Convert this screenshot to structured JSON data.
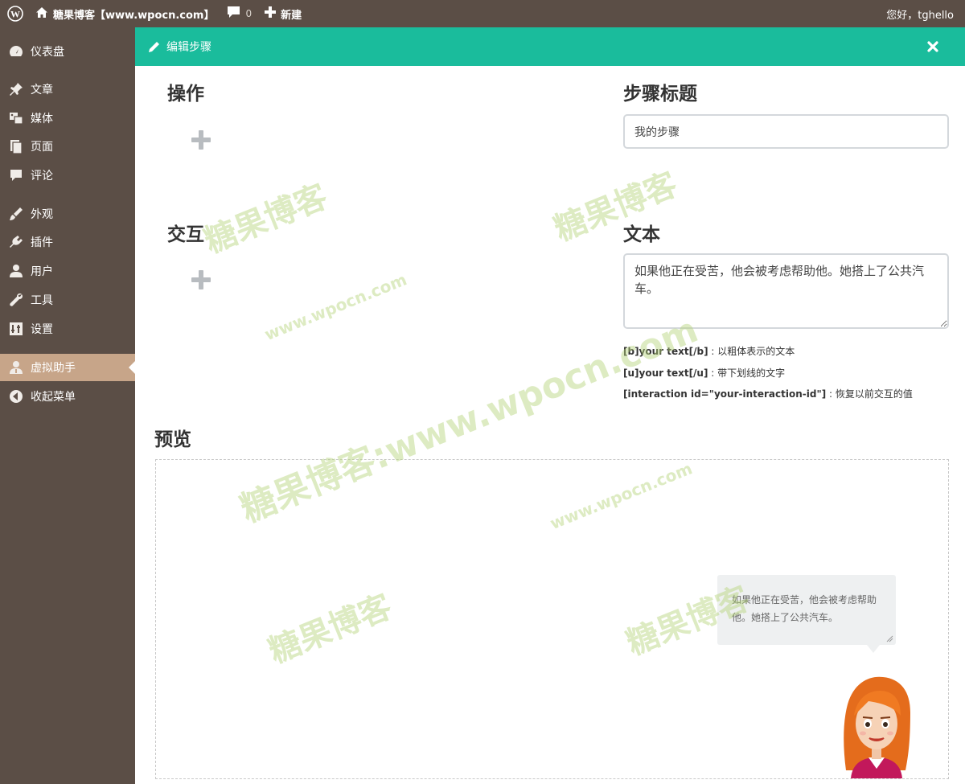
{
  "adminbar": {
    "site_name": "糖果博客【www.wpocn.com】",
    "comments_count": "0",
    "new_label": "新建",
    "greeting": "您好，tghello"
  },
  "sidebar": {
    "items": [
      {
        "label": "仪表盘",
        "icon": "dashboard-icon"
      },
      {
        "label": "文章",
        "icon": "pin-icon"
      },
      {
        "label": "媒体",
        "icon": "media-icon"
      },
      {
        "label": "页面",
        "icon": "pages-icon"
      },
      {
        "label": "评论",
        "icon": "comments-icon"
      },
      {
        "label": "外观",
        "icon": "appearance-icon"
      },
      {
        "label": "插件",
        "icon": "plugins-icon"
      },
      {
        "label": "用户",
        "icon": "users-icon"
      },
      {
        "label": "工具",
        "icon": "tools-icon"
      },
      {
        "label": "设置",
        "icon": "settings-icon"
      },
      {
        "label": "虚拟助手",
        "icon": "assistant-icon"
      },
      {
        "label": "收起菜单",
        "icon": "collapse-icon"
      }
    ],
    "active_index": 10
  },
  "modal": {
    "title": "编辑步骤"
  },
  "sections": {
    "actions": "操作",
    "interactions": "交互",
    "step_title": "步骤标题",
    "text": "文本",
    "preview": "预览"
  },
  "step_title_value": "我的步骤",
  "text_value": "如果他正在受苦，他会被考虑帮助他。她搭上了公共汽车。",
  "hints": [
    {
      "code": "[b]your text[/b]",
      "desc": " : 以粗体表示的文本"
    },
    {
      "code": "[u]your text[/u]",
      "desc": " : 带下划线的文字"
    },
    {
      "code": "[interaction id=\"your-interaction-id\"]",
      "desc": " : 恢复以前交互的值"
    }
  ],
  "preview_bubble_text": "如果他正在受苦，他会被考虑帮助他。她搭上了公共汽车。",
  "watermarks": {
    "brand": "糖果博客",
    "url": "www.wpocn.com",
    "combined": "糖果博客:www.wpocn.com"
  },
  "colors": {
    "adminbar": "#5b4e46",
    "sidebar_active": "#c7a589",
    "modal_header": "#1abc9c"
  }
}
